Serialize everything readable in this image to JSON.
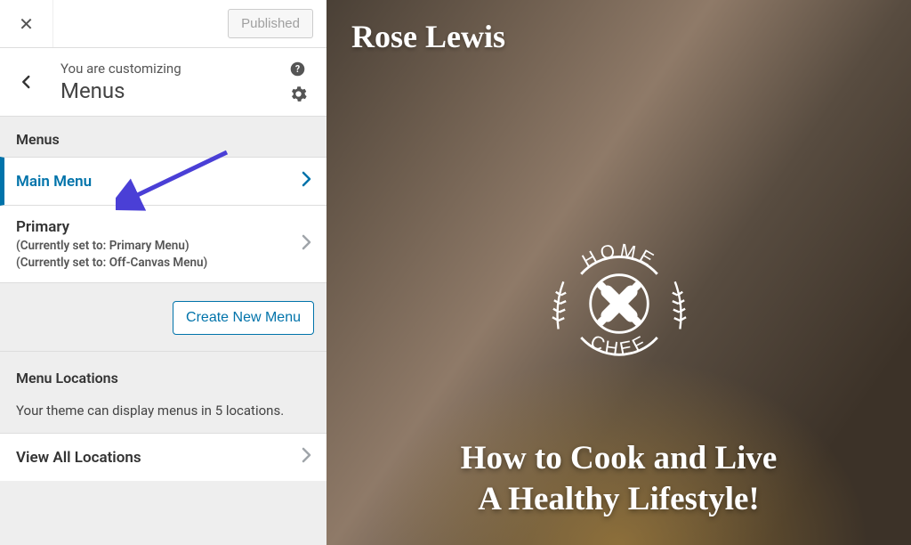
{
  "topbar": {
    "publish_label": "Published"
  },
  "header": {
    "customizing_label": "You are customizing",
    "section_title": "Menus"
  },
  "menus": {
    "label": "Menus",
    "items": [
      {
        "title": "Main Menu",
        "subs": []
      },
      {
        "title": "Primary",
        "subs": [
          "(Currently set to: Primary Menu)",
          "(Currently set to: Off-Canvas Menu)"
        ]
      }
    ],
    "create_label": "Create New Menu"
  },
  "locations": {
    "label": "Menu Locations",
    "description": "Your theme can display menus in 5 locations.",
    "view_all_label": "View All Locations"
  },
  "preview": {
    "site_name": "Rose Lewis",
    "badge_top": "HOME",
    "badge_bottom": "CHEF",
    "hero_line1": "How to Cook and Live",
    "hero_line2": "A Healthy Lifestyle!"
  }
}
